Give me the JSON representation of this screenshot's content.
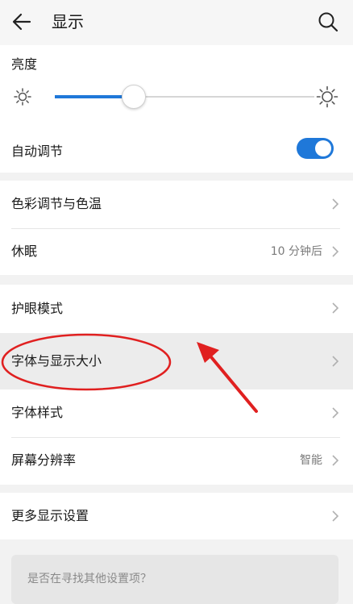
{
  "header": {
    "title": "显示",
    "back_icon": "arrow-left-icon",
    "search_icon": "search-icon"
  },
  "brightness": {
    "label": "亮度",
    "level_fraction": 0.3
  },
  "auto_adjust": {
    "label": "自动调节",
    "enabled": true
  },
  "rows": [
    {
      "label": "色彩调节与色温",
      "value": ""
    },
    {
      "label": "休眠",
      "value": "10 分钟后"
    },
    {
      "label": "护眼模式",
      "value": ""
    },
    {
      "label": "字体与显示大小",
      "value": ""
    },
    {
      "label": "字体样式",
      "value": ""
    },
    {
      "label": "屏幕分辨率",
      "value": "智能"
    },
    {
      "label": "更多显示设置",
      "value": ""
    }
  ],
  "search_suggestion": {
    "text": "是否在寻找其他设置项？"
  },
  "colors": {
    "accent": "#1f78d9",
    "annotation": "#e02020"
  }
}
